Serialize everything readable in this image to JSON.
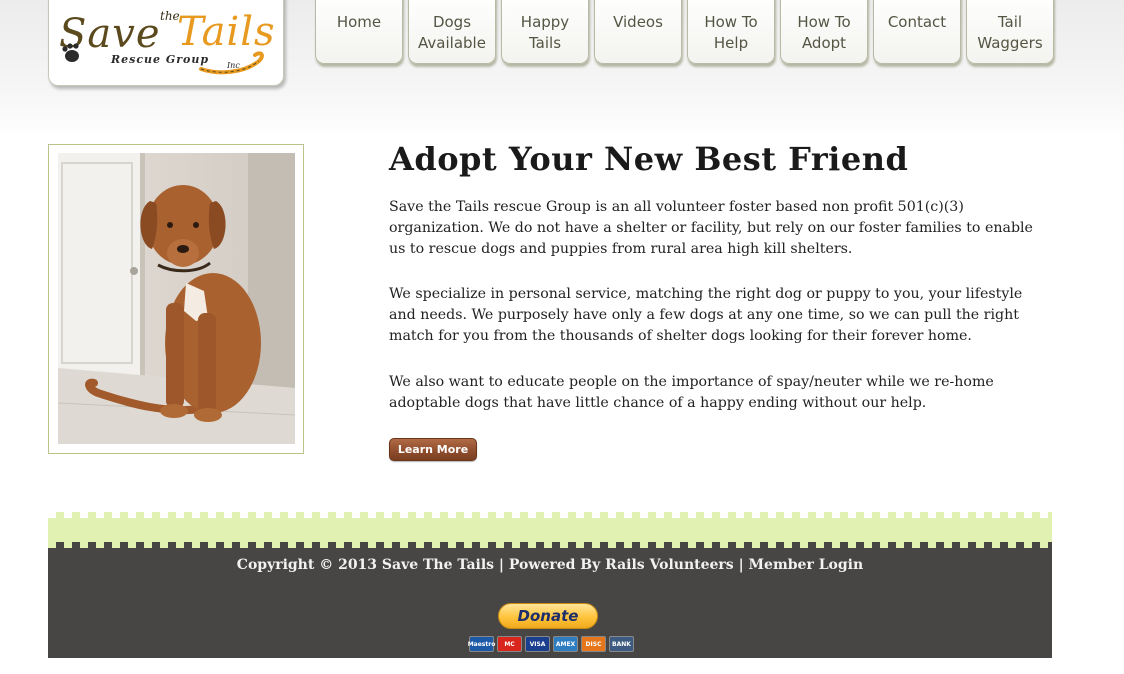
{
  "logo": {
    "save": "Save",
    "the": "the",
    "tails": "Tails",
    "rescue_group": "Rescue Group",
    "inc": "Inc"
  },
  "nav": {
    "items": [
      {
        "label": "Home"
      },
      {
        "label": "Dogs\nAvailable"
      },
      {
        "label": "Happy\nTails"
      },
      {
        "label": "Videos"
      },
      {
        "label": "How To\nHelp"
      },
      {
        "label": "How To\nAdopt"
      },
      {
        "label": "Contact"
      },
      {
        "label": "Tail\nWaggers"
      }
    ]
  },
  "main": {
    "heading": "Adopt Your New Best Friend",
    "paragraphs": [
      "Save the Tails rescue Group is an all volunteer foster based non profit 501(c)(3) organization. We do not have a shelter or facility, but rely on our foster families to enable us to rescue dogs and puppies from rural area high kill shelters.",
      "We specialize in personal service, matching the right dog or puppy to you, your lifestyle and needs. We purposely have only a few dogs at any one time, so we can pull the right match for you from the thousands of shelter dogs looking for their forever home.",
      "We also want to educate people on the importance of spay/neuter while we re-home adoptable dogs that have little chance of a happy ending without our help."
    ],
    "learn_more": "Learn More"
  },
  "footer": {
    "copyright": "Copyright © 2013 Save The Tails",
    "separator": " | ",
    "powered_by": "Powered By Rails Volunteers",
    "member_login": "Member Login",
    "donate": "Donate",
    "cards": [
      {
        "name": "Maestro",
        "color": "#1c5aa8"
      },
      {
        "name": "MC",
        "color": "#d9261c"
      },
      {
        "name": "VISA",
        "color": "#1a3f8f"
      },
      {
        "name": "AMEX",
        "color": "#2f7dc1"
      },
      {
        "name": "DISC",
        "color": "#e5761b"
      },
      {
        "name": "BANK",
        "color": "#3d5a80"
      }
    ]
  },
  "colors": {
    "footer_dark": "#474644",
    "footer_green": "#e0f1b2",
    "button_brown": "#8e4c2c",
    "logo_orange": "#e79a1f"
  }
}
